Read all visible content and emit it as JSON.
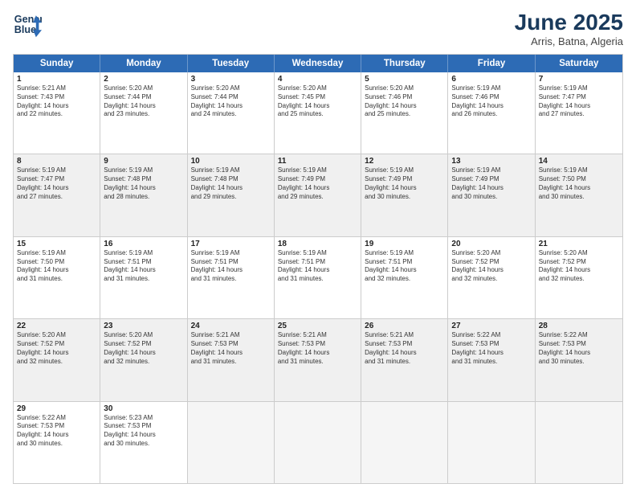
{
  "header": {
    "logo_line1": "General",
    "logo_line2": "Blue",
    "main_title": "June 2025",
    "subtitle": "Arris, Batna, Algeria"
  },
  "calendar": {
    "days_of_week": [
      "Sunday",
      "Monday",
      "Tuesday",
      "Wednesday",
      "Thursday",
      "Friday",
      "Saturday"
    ],
    "rows": [
      [
        {
          "day": "1",
          "info": "Sunrise: 5:21 AM\nSunset: 7:43 PM\nDaylight: 14 hours\nand 22 minutes."
        },
        {
          "day": "2",
          "info": "Sunrise: 5:20 AM\nSunset: 7:44 PM\nDaylight: 14 hours\nand 23 minutes."
        },
        {
          "day": "3",
          "info": "Sunrise: 5:20 AM\nSunset: 7:44 PM\nDaylight: 14 hours\nand 24 minutes."
        },
        {
          "day": "4",
          "info": "Sunrise: 5:20 AM\nSunset: 7:45 PM\nDaylight: 14 hours\nand 25 minutes."
        },
        {
          "day": "5",
          "info": "Sunrise: 5:20 AM\nSunset: 7:46 PM\nDaylight: 14 hours\nand 25 minutes."
        },
        {
          "day": "6",
          "info": "Sunrise: 5:19 AM\nSunset: 7:46 PM\nDaylight: 14 hours\nand 26 minutes."
        },
        {
          "day": "7",
          "info": "Sunrise: 5:19 AM\nSunset: 7:47 PM\nDaylight: 14 hours\nand 27 minutes."
        }
      ],
      [
        {
          "day": "8",
          "info": "Sunrise: 5:19 AM\nSunset: 7:47 PM\nDaylight: 14 hours\nand 27 minutes."
        },
        {
          "day": "9",
          "info": "Sunrise: 5:19 AM\nSunset: 7:48 PM\nDaylight: 14 hours\nand 28 minutes."
        },
        {
          "day": "10",
          "info": "Sunrise: 5:19 AM\nSunset: 7:48 PM\nDaylight: 14 hours\nand 29 minutes."
        },
        {
          "day": "11",
          "info": "Sunrise: 5:19 AM\nSunset: 7:49 PM\nDaylight: 14 hours\nand 29 minutes."
        },
        {
          "day": "12",
          "info": "Sunrise: 5:19 AM\nSunset: 7:49 PM\nDaylight: 14 hours\nand 30 minutes."
        },
        {
          "day": "13",
          "info": "Sunrise: 5:19 AM\nSunset: 7:49 PM\nDaylight: 14 hours\nand 30 minutes."
        },
        {
          "day": "14",
          "info": "Sunrise: 5:19 AM\nSunset: 7:50 PM\nDaylight: 14 hours\nand 30 minutes."
        }
      ],
      [
        {
          "day": "15",
          "info": "Sunrise: 5:19 AM\nSunset: 7:50 PM\nDaylight: 14 hours\nand 31 minutes."
        },
        {
          "day": "16",
          "info": "Sunrise: 5:19 AM\nSunset: 7:51 PM\nDaylight: 14 hours\nand 31 minutes."
        },
        {
          "day": "17",
          "info": "Sunrise: 5:19 AM\nSunset: 7:51 PM\nDaylight: 14 hours\nand 31 minutes."
        },
        {
          "day": "18",
          "info": "Sunrise: 5:19 AM\nSunset: 7:51 PM\nDaylight: 14 hours\nand 31 minutes."
        },
        {
          "day": "19",
          "info": "Sunrise: 5:19 AM\nSunset: 7:51 PM\nDaylight: 14 hours\nand 32 minutes."
        },
        {
          "day": "20",
          "info": "Sunrise: 5:20 AM\nSunset: 7:52 PM\nDaylight: 14 hours\nand 32 minutes."
        },
        {
          "day": "21",
          "info": "Sunrise: 5:20 AM\nSunset: 7:52 PM\nDaylight: 14 hours\nand 32 minutes."
        }
      ],
      [
        {
          "day": "22",
          "info": "Sunrise: 5:20 AM\nSunset: 7:52 PM\nDaylight: 14 hours\nand 32 minutes."
        },
        {
          "day": "23",
          "info": "Sunrise: 5:20 AM\nSunset: 7:52 PM\nDaylight: 14 hours\nand 32 minutes."
        },
        {
          "day": "24",
          "info": "Sunrise: 5:21 AM\nSunset: 7:53 PM\nDaylight: 14 hours\nand 31 minutes."
        },
        {
          "day": "25",
          "info": "Sunrise: 5:21 AM\nSunset: 7:53 PM\nDaylight: 14 hours\nand 31 minutes."
        },
        {
          "day": "26",
          "info": "Sunrise: 5:21 AM\nSunset: 7:53 PM\nDaylight: 14 hours\nand 31 minutes."
        },
        {
          "day": "27",
          "info": "Sunrise: 5:22 AM\nSunset: 7:53 PM\nDaylight: 14 hours\nand 31 minutes."
        },
        {
          "day": "28",
          "info": "Sunrise: 5:22 AM\nSunset: 7:53 PM\nDaylight: 14 hours\nand 30 minutes."
        }
      ],
      [
        {
          "day": "29",
          "info": "Sunrise: 5:22 AM\nSunset: 7:53 PM\nDaylight: 14 hours\nand 30 minutes."
        },
        {
          "day": "30",
          "info": "Sunrise: 5:23 AM\nSunset: 7:53 PM\nDaylight: 14 hours\nand 30 minutes."
        },
        {
          "day": "",
          "info": ""
        },
        {
          "day": "",
          "info": ""
        },
        {
          "day": "",
          "info": ""
        },
        {
          "day": "",
          "info": ""
        },
        {
          "day": "",
          "info": ""
        }
      ]
    ]
  }
}
